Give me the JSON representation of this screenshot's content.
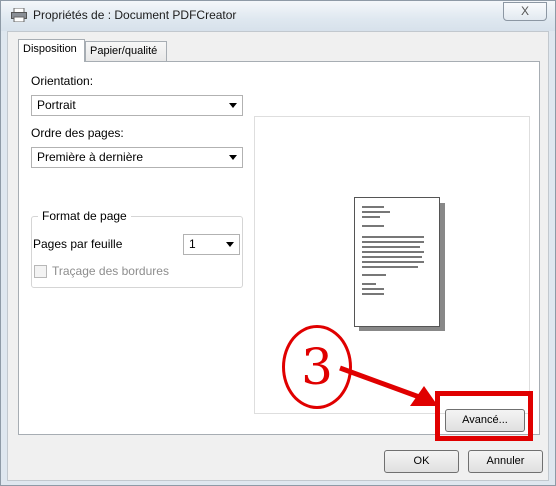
{
  "window": {
    "title": "Propriétés de : Document PDFCreator",
    "close_label": "X"
  },
  "tabs": [
    {
      "label": "Disposition",
      "active": true
    },
    {
      "label": "Papier/qualité",
      "active": false
    }
  ],
  "orientation": {
    "label": "Orientation:",
    "value": "Portrait"
  },
  "page_order": {
    "label": "Ordre des pages:",
    "value": "Première à dernière"
  },
  "page_format": {
    "group_label": "Format de page",
    "pages_per_sheet_label": "Pages par feuille",
    "pages_per_sheet_value": "1",
    "borders_label": "Traçage des bordures",
    "borders_checked": false
  },
  "buttons": {
    "advanced": "Avancé...",
    "ok": "OK",
    "cancel": "Annuler"
  },
  "annotation": {
    "step_number": "3",
    "color": "#e00000"
  }
}
